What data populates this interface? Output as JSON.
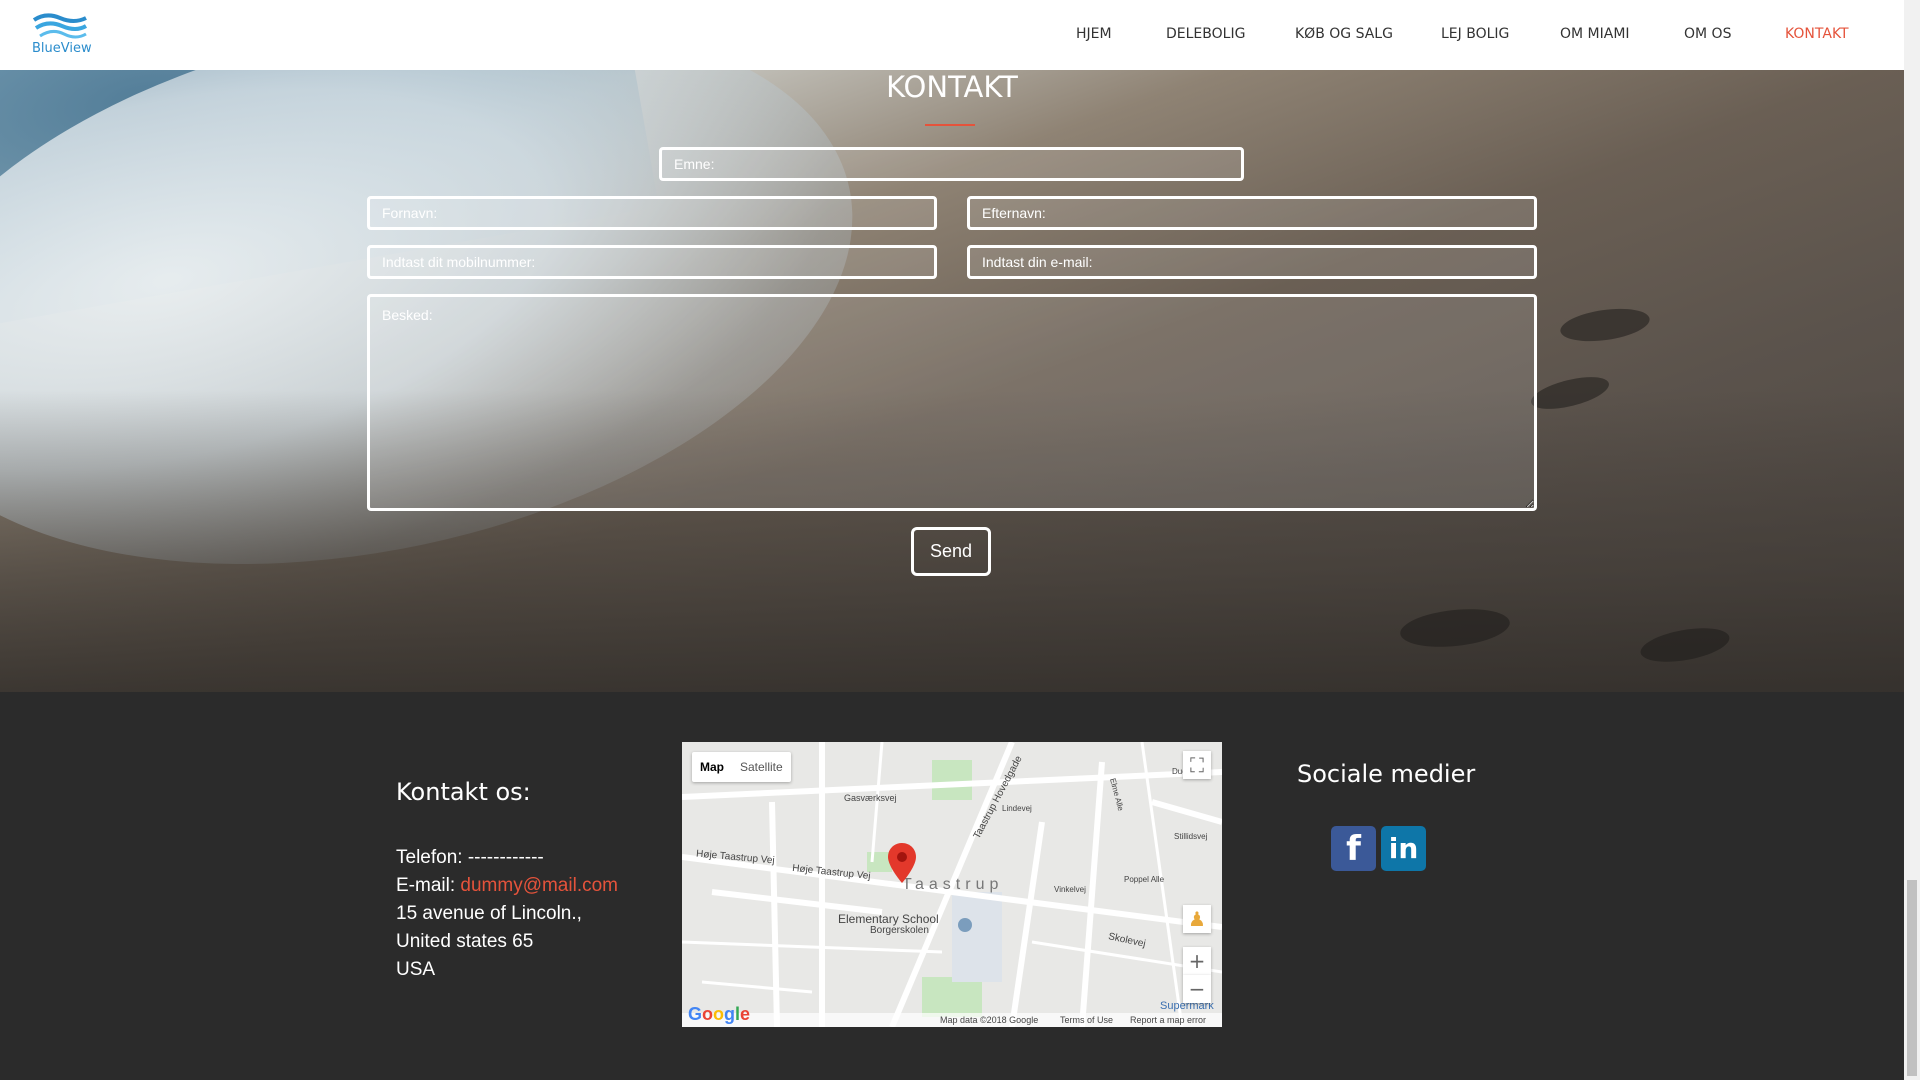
{
  "brand": {
    "name": "BlueView"
  },
  "nav": {
    "items": [
      {
        "label": "HJEM",
        "active": false
      },
      {
        "label": "DELEBOLIG",
        "active": false
      },
      {
        "label": "KØB OG SALG",
        "active": false
      },
      {
        "label": "LEJ BOLIG",
        "active": false
      },
      {
        "label": "OM MIAMI",
        "active": false
      },
      {
        "label": "OM OS",
        "active": false
      },
      {
        "label": "KONTAKT",
        "active": true
      }
    ]
  },
  "form": {
    "title": "KONTAKT",
    "subject_placeholder": "Emne:",
    "firstname_placeholder": "Fornavn:",
    "lastname_placeholder": "Efternavn:",
    "phone_placeholder": "Indtast dit mobilnummer:",
    "email_placeholder": "Indtast din e-mail:",
    "message_placeholder": "Besked:",
    "send_label": "Send"
  },
  "contact": {
    "title": "Kontakt os:",
    "phone_label": "Telefon:",
    "phone_value": "------------",
    "email_label": "E-mail:",
    "email_value": "dummy@mail.com",
    "address_line1": "15 avenue of Lincoln.,",
    "address_line2": "United states 65",
    "address_line3": "USA"
  },
  "map": {
    "tab_map": "Map",
    "tab_satellite": "Satellite",
    "place": "Taastrup",
    "streets": [
      "Gasværksvej",
      "Høje Taastrup Vej",
      "Taastrup Hovedgade",
      "Lindevej",
      "Skolevej",
      "Vinkelvej",
      "Poppel Alle",
      "Stillidsvej",
      "Elme Alle",
      "Duevej"
    ],
    "poi": "Elementary School",
    "poi_sub": "Borgerskolen",
    "corner_poi": "Supermark",
    "google": "Google",
    "data_text": "Map data ©2018 Google",
    "terms": "Terms of Use",
    "report": "Report a map error"
  },
  "social": {
    "title": "Sociale medier",
    "facebook_glyph": "f",
    "linkedin_glyph": "in"
  },
  "colors": {
    "accent": "#e5533b",
    "footer_bg": "#2b2b2b",
    "brand_blue": "#2a8ccc"
  }
}
